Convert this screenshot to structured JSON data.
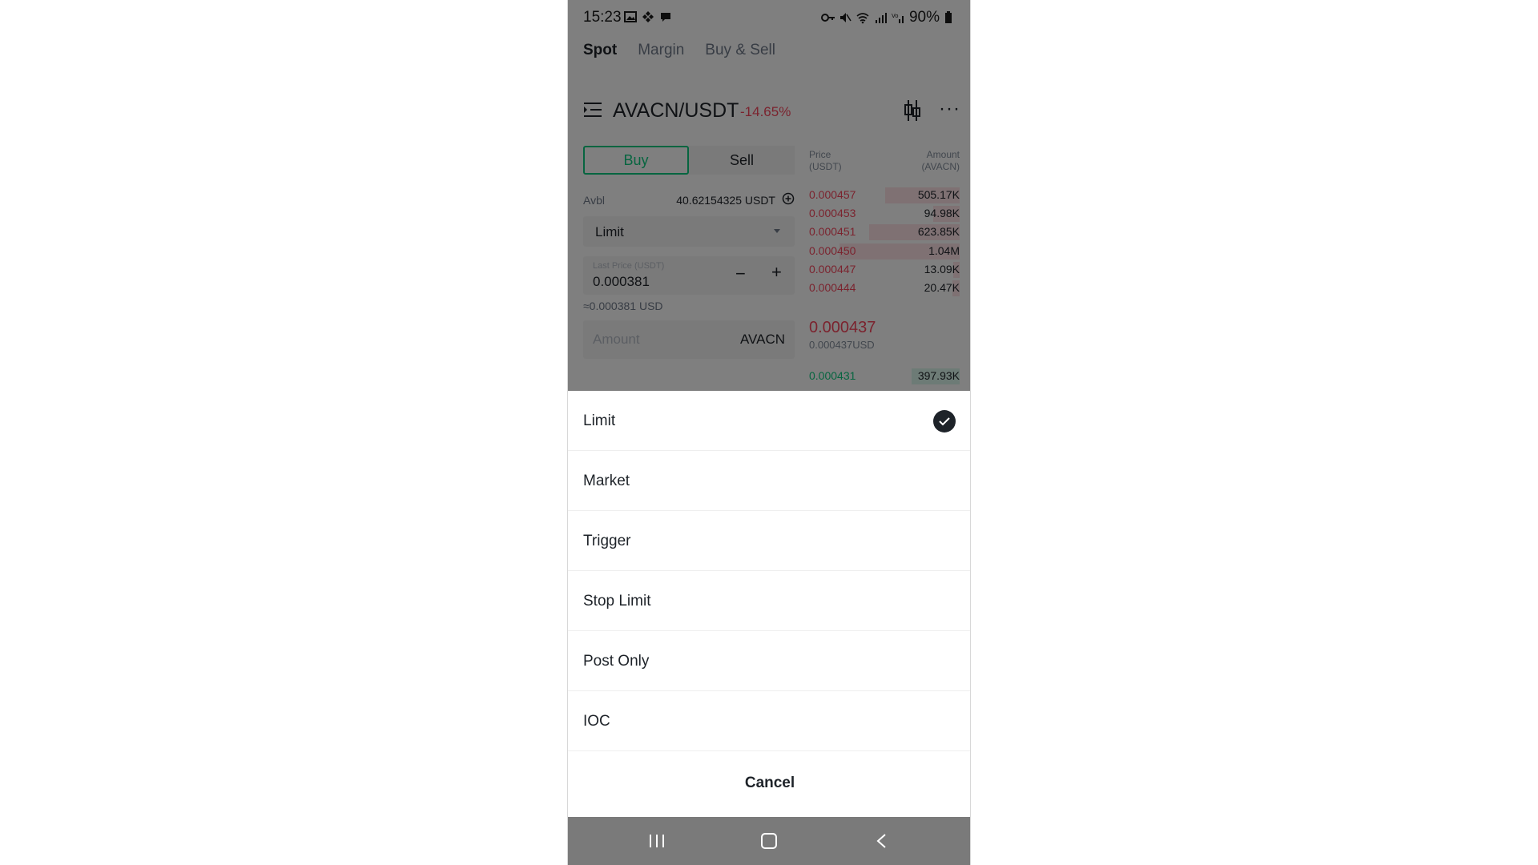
{
  "status_bar": {
    "time": "15:23",
    "battery": "90%"
  },
  "tabs": [
    {
      "label": "Spot",
      "active": true
    },
    {
      "label": "Margin",
      "active": false
    },
    {
      "label": "Buy & Sell",
      "active": false
    }
  ],
  "pair": {
    "name": "AVACN/USDT",
    "change": "-14.65%"
  },
  "trade": {
    "buy_label": "Buy",
    "sell_label": "Sell",
    "avbl_label": "Avbl",
    "avbl_value": "40.62154325 USDT",
    "order_type": "Limit",
    "price_placeholder": "Last Price (USDT)",
    "price_value": "0.000381",
    "price_usd": "≈0.000381 USD",
    "amount_placeholder": "Amount",
    "amount_unit": "AVACN"
  },
  "order_book": {
    "price_header": "Price\n(USDT)",
    "amount_header": "Amount\n(AVACN)",
    "asks": [
      {
        "price": "0.000457",
        "amount": "505.17K",
        "depth": 0.62
      },
      {
        "price": "0.000453",
        "amount": "94.98K",
        "depth": 0.22
      },
      {
        "price": "0.000451",
        "amount": "623.85K",
        "depth": 0.75
      },
      {
        "price": "0.000450",
        "amount": "1.04M",
        "depth": 1.0
      },
      {
        "price": "0.000447",
        "amount": "13.09K",
        "depth": 0.05
      },
      {
        "price": "0.000444",
        "amount": "20.47K",
        "depth": 0.06
      }
    ],
    "last_price": "0.000437",
    "last_price_usd": "0.000437USD",
    "bids": [
      {
        "price": "0.000431",
        "amount": "397.93K",
        "depth": 0.4
      }
    ]
  },
  "order_type_sheet": {
    "options": [
      {
        "label": "Limit",
        "selected": true
      },
      {
        "label": "Market",
        "selected": false
      },
      {
        "label": "Trigger",
        "selected": false
      },
      {
        "label": "Stop Limit",
        "selected": false
      },
      {
        "label": "Post Only",
        "selected": false
      },
      {
        "label": "IOC",
        "selected": false
      }
    ],
    "cancel_label": "Cancel"
  },
  "colors": {
    "green": "#0ecb81",
    "red": "#f6465d",
    "text": "#1e2329"
  }
}
